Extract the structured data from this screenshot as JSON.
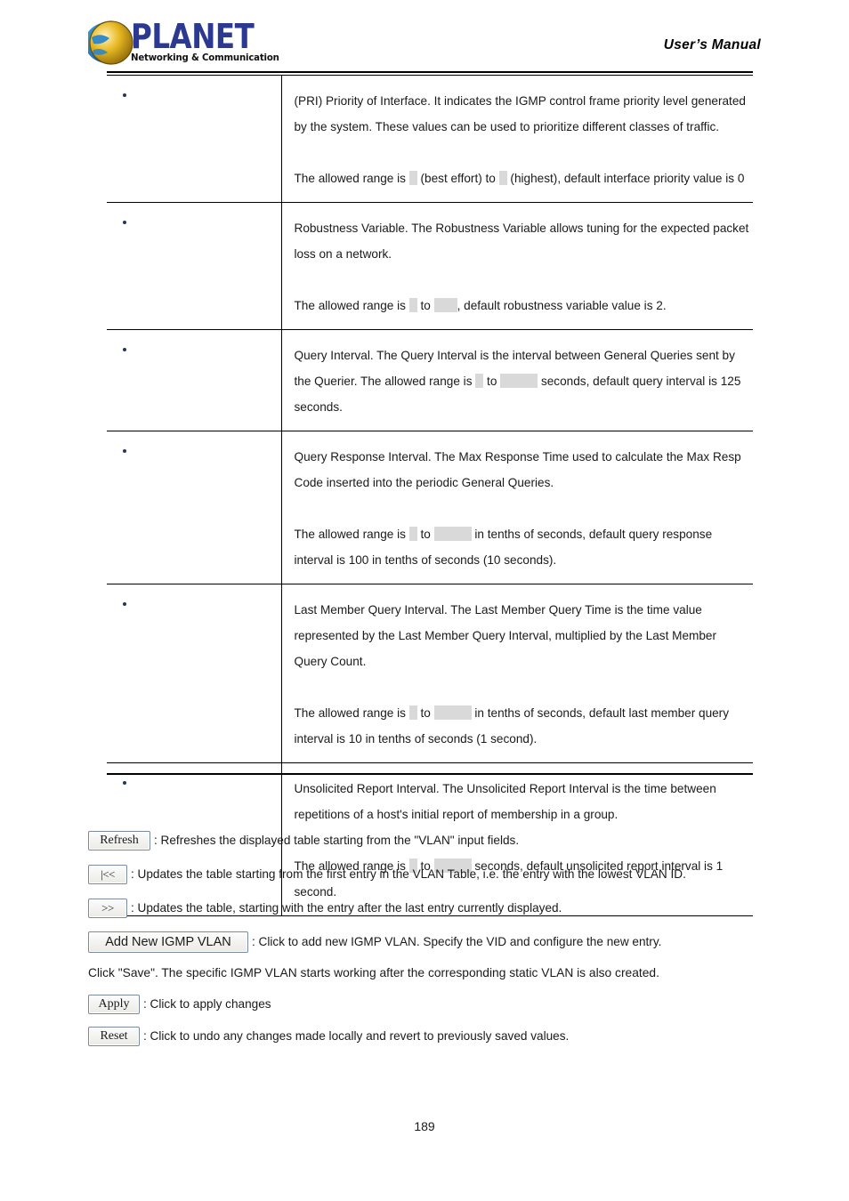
{
  "header": {
    "logo_name": "PLANET",
    "logo_tagline": "Networking & Communication",
    "manual_title": "User’s Manual"
  },
  "table": {
    "rows": [
      {
        "name": "",
        "paragraphs": [
          {
            "segments": [
              {
                "type": "text",
                "value": "(PRI) Priority of Interface. It indicates the IGMP control frame priority level generated by the system. These values can be used to prioritize different classes of traffic."
              }
            ]
          },
          {
            "segments": [
              {
                "type": "text",
                "value": "The allowed range is "
              },
              {
                "type": "redact",
                "width": "w1"
              },
              {
                "type": "text",
                "value": " (best effort) to "
              },
              {
                "type": "redact",
                "width": "w1"
              },
              {
                "type": "text",
                "value": " (highest), default interface priority value is 0"
              }
            ]
          }
        ]
      },
      {
        "name": "",
        "paragraphs": [
          {
            "segments": [
              {
                "type": "text",
                "value": "Robustness Variable. The Robustness Variable allows tuning for the expected packet loss on a network."
              }
            ]
          },
          {
            "segments": [
              {
                "type": "text",
                "value": "The allowed range is "
              },
              {
                "type": "redact",
                "width": "w1"
              },
              {
                "type": "text",
                "value": " to "
              },
              {
                "type": "redact",
                "width": "w2"
              },
              {
                "type": "text",
                "value": ", default robustness variable value is 2."
              }
            ]
          }
        ]
      },
      {
        "name": "",
        "paragraphs": [
          {
            "segments": [
              {
                "type": "text",
                "value": "Query Interval. The Query Interval is the interval between General Queries sent by the Querier. The allowed range is "
              },
              {
                "type": "redact",
                "width": "w1"
              },
              {
                "type": "text",
                "value": " to "
              },
              {
                "type": "redact",
                "width": "w3"
              },
              {
                "type": "text",
                "value": " seconds, default query interval is 125 seconds."
              }
            ]
          }
        ]
      },
      {
        "name": "",
        "paragraphs": [
          {
            "segments": [
              {
                "type": "text",
                "value": "Query Response Interval. The Max Response Time used to calculate the Max Resp Code inserted into the periodic General Queries."
              }
            ]
          },
          {
            "segments": [
              {
                "type": "text",
                "value": "The allowed range is "
              },
              {
                "type": "redact",
                "width": "w1"
              },
              {
                "type": "text",
                "value": " to "
              },
              {
                "type": "redact",
                "width": "w3"
              },
              {
                "type": "text",
                "value": " in tenths of seconds, default query response interval is 100 in tenths of seconds (10 seconds)."
              }
            ]
          }
        ]
      },
      {
        "name": "",
        "paragraphs": [
          {
            "segments": [
              {
                "type": "text",
                "value": "Last Member Query Interval. The Last Member Query Time is the time value represented by the Last Member Query Interval, multiplied by the Last Member Query Count."
              }
            ]
          },
          {
            "segments": [
              {
                "type": "text",
                "value": "The allowed range is "
              },
              {
                "type": "redact",
                "width": "w1"
              },
              {
                "type": "text",
                "value": " to "
              },
              {
                "type": "redact",
                "width": "w3"
              },
              {
                "type": "text",
                "value": " in tenths of seconds, default last member query interval is 10 in tenths of seconds (1 second)."
              }
            ]
          }
        ]
      },
      {
        "name": "",
        "paragraphs": [
          {
            "segments": [
              {
                "type": "text",
                "value": "Unsolicited Report Interval. The Unsolicited Report Interval is the time between repetitions of a host's initial report of membership in a group."
              }
            ]
          },
          {
            "segments": [
              {
                "type": "text",
                "value": "The allowed range is "
              },
              {
                "type": "redact",
                "width": "w1"
              },
              {
                "type": "text",
                "value": " to "
              },
              {
                "type": "redact",
                "width": "w3"
              },
              {
                "type": "text",
                "value": " seconds, default unsolicited report interval is 1 second."
              }
            ]
          }
        ]
      }
    ]
  },
  "buttons": {
    "refresh": {
      "label": "Refresh",
      "description": ": Refreshes the displayed table starting from the \"VLAN\" input fields."
    },
    "first": {
      "label": "|<<",
      "description": ": Updates the table starting from the first entry in the VLAN Table, i.e. the entry with the lowest VLAN ID."
    },
    "next": {
      "label": ">>",
      "description": ": Updates the table, starting with the entry after the last entry currently displayed."
    },
    "add_new_igmp_vlan": {
      "label": "Add New IGMP VLAN",
      "description": ": Click to add new IGMP VLAN. Specify the VID and configure the new entry."
    },
    "apply": {
      "label": "Apply",
      "description": ": Click to apply changes"
    },
    "reset": {
      "label": "Reset",
      "description": ": Click to undo any changes made locally and revert to previously saved values."
    }
  },
  "save_note": "Click \"Save\". The specific IGMP VLAN starts working after the corresponding static VLAN is also created.",
  "footer": {
    "page_number": "189"
  },
  "colors": {
    "logo_blue": "#2B3990",
    "bullet": "#1F3864",
    "redact": "#d9d9d9"
  }
}
